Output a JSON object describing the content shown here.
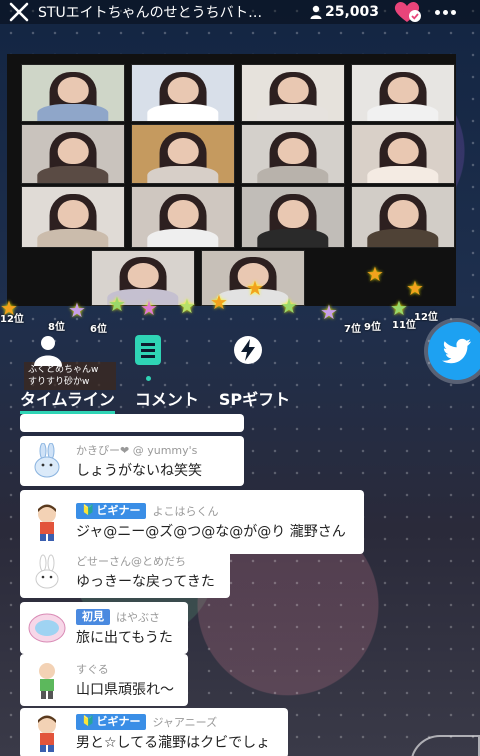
{
  "header": {
    "title": "STUエイトちゃんのせとうちバト…",
    "viewers": "25,003"
  },
  "video": {
    "tiles": [
      {
        "name": "",
        "shirt": "#8fa6c9",
        "bg": "#cfd6c8"
      },
      {
        "name": "",
        "shirt": "#ffffff",
        "bg": "#d8dfe9"
      },
      {
        "name": "",
        "shirt": "#e6e2de",
        "bg": "#e6e2dc"
      },
      {
        "name": "",
        "shirt": "#f1f1f1",
        "bg": "#e7e5e2"
      },
      {
        "name": "",
        "shirt": "#5a4b44",
        "bg": "#c9c3bd"
      },
      {
        "name": "",
        "shirt": "#d7cfc8",
        "bg": "#c59a5f"
      },
      {
        "name": "",
        "shirt": "#b8b2ab",
        "bg": "#d4d0cb"
      },
      {
        "name": "",
        "shirt": "#f4ebe3",
        "bg": "#d9d0c8"
      },
      {
        "name": "",
        "shirt": "#cbbcac",
        "bg": "#e0dbd6"
      },
      {
        "name": "",
        "shirt": "#efefef",
        "bg": "#cfc7c0"
      },
      {
        "name": "",
        "shirt": "#2a2a2a",
        "bg": "#c1bdb8"
      },
      {
        "name": "",
        "shirt": "#4f4236",
        "bg": "#d2cdc7"
      },
      {
        "name": "",
        "shirt": "#c5c0d0",
        "bg": "#d8d3ce"
      },
      {
        "name": "",
        "shirt": "#e2e2e2",
        "bg": "#c7c0b8"
      }
    ]
  },
  "ranks": [
    "12位",
    "8位",
    "6位",
    "7位",
    "9位",
    "11位",
    "12位"
  ],
  "user_banner": {
    "line1": "ふくとめちゃんw",
    "line2": "すりすり砂かw"
  },
  "tabs": {
    "timeline": "タイムライン",
    "comment": "コメント",
    "sp_gift": "SPギフト"
  },
  "comments": [
    {
      "user": "",
      "badge": "",
      "text": "",
      "avatar": "partial"
    },
    {
      "user": "かきぴー❤ @ yummy's",
      "badge": "",
      "text": "しょうがないね笑笑",
      "avatar": "rabbit-blue"
    },
    {
      "user": "よこはらくん",
      "badge": "ビギナー",
      "text": "ジャ@ニー@ズ@つ@な@が@り 瀧野さん",
      "avatar": "boy"
    },
    {
      "user": "どせーさん@とめだち",
      "badge": "",
      "text": "ゆっきーな戻ってきた",
      "avatar": "rabbit-white"
    },
    {
      "user": "はやぶさ",
      "badge": "初見",
      "text": "旅に出てもうた",
      "avatar": "badge-logo"
    },
    {
      "user": "すぐる",
      "badge": "",
      "text": "山口県頑張れ〜",
      "avatar": "kid-green"
    },
    {
      "user": "ジャアニーズ",
      "badge": "ビギナー",
      "text": "男と☆してる瀧野はクビでしょ",
      "avatar": "boy"
    }
  ]
}
